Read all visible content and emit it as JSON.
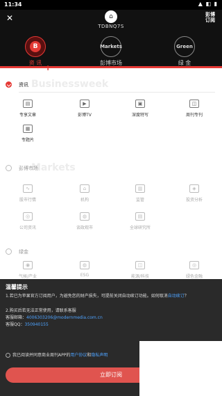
{
  "status": {
    "time": "11:34",
    "icons": "▲ ◧ ▮"
  },
  "header": {
    "close_glyph": "✕",
    "avatar_glyph": "⌂",
    "username": "TDBNQ7S",
    "brand_line1": "彭博",
    "brand_line2": "订阅",
    "tabs": [
      {
        "logo": "B",
        "label": "资 讯"
      },
      {
        "logo": "Markets",
        "label": "彭博市场"
      },
      {
        "logo": "Green",
        "label": "绿 金"
      }
    ]
  },
  "sections": [
    {
      "title": "资讯",
      "bg": "Businessweek",
      "items": [
        {
          "icon": "▤",
          "label": "专享文章"
        },
        {
          "icon": "▶",
          "label": "彭博TV"
        },
        {
          "icon": "▣",
          "label": "深度特写"
        },
        {
          "icon": "◫",
          "label": "周刊专刊"
        },
        {
          "icon": "▦",
          "label": "专题片"
        }
      ]
    },
    {
      "title": "彭博市场",
      "bg": "Markets",
      "items": [
        {
          "icon": "∿",
          "label": "股市行情"
        },
        {
          "icon": "⌂",
          "label": "机构"
        },
        {
          "icon": "▥",
          "label": "监管"
        },
        {
          "icon": "◈",
          "label": "投资分析"
        },
        {
          "icon": "◎",
          "label": "公司资讯"
        },
        {
          "icon": "◍",
          "label": "谈政观市"
        },
        {
          "icon": "▤",
          "label": "全球研究所"
        }
      ]
    },
    {
      "title": "绿金",
      "bg": "",
      "items": [
        {
          "icon": "◉",
          "label": "气候/产业"
        },
        {
          "icon": "◍",
          "label": "ESG"
        },
        {
          "icon": "◫",
          "label": "能源/科技"
        },
        {
          "icon": "◎",
          "label": "绿色金融"
        }
      ]
    }
  ],
  "notice": {
    "title": "温馨提示",
    "line1a": "1.若已为苹果官方订阅用户，为避免您的财产损失，可提前关闭自动续订功能。如何取消",
    "line1b": "自动续订",
    "line1c": "？",
    "line2": "2.购买后若无法正常使用，请联系客服",
    "line3a": "客服邮箱：",
    "line3b": "4006303206@modernmedia.com.cn",
    "line4a": "客服QQ：",
    "line4b": "350940155",
    "agree_a": "我已阅读并同意商业周刊APP的",
    "agree_b": "用户协议",
    "agree_c": "和",
    "agree_d": "隐私声明",
    "button": "立即订阅"
  }
}
